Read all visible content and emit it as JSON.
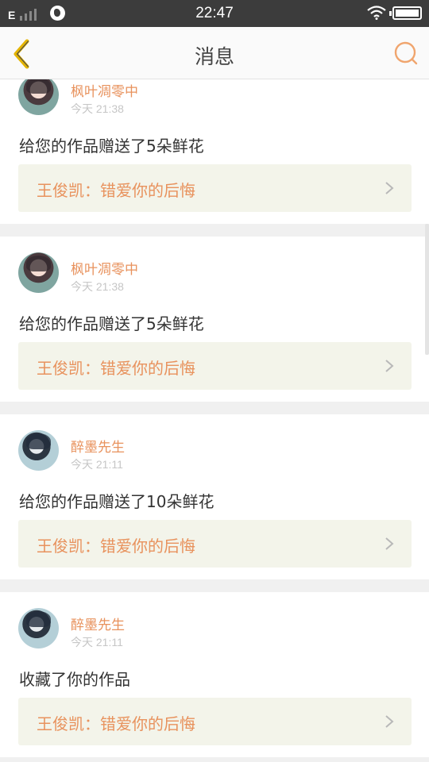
{
  "status_bar": {
    "network": "E",
    "time": "22:47"
  },
  "header": {
    "title": "消息",
    "back_icon": "chevron-left-icon",
    "search_icon": "search-icon"
  },
  "colors": {
    "accent": "#e8925d",
    "back_arrow": "#e4b400",
    "link_bg": "#f3f4ea"
  },
  "messages": [
    {
      "user": "枫叶凋零中",
      "time": "今天 21:38",
      "text": "给您的作品赠送了5朵鲜花",
      "work": "王俊凯：错爱你的后悔"
    },
    {
      "user": "枫叶凋零中",
      "time": "今天 21:38",
      "text": "给您的作品赠送了5朵鲜花",
      "work": "王俊凯：错爱你的后悔"
    },
    {
      "user": "醉墨先生",
      "time": "今天 21:11",
      "text": "给您的作品赠送了10朵鲜花",
      "work": "王俊凯：错爱你的后悔"
    },
    {
      "user": "醉墨先生",
      "time": "今天 21:11",
      "text": "收藏了你的作品",
      "work": "王俊凯：错爱你的后悔"
    }
  ]
}
